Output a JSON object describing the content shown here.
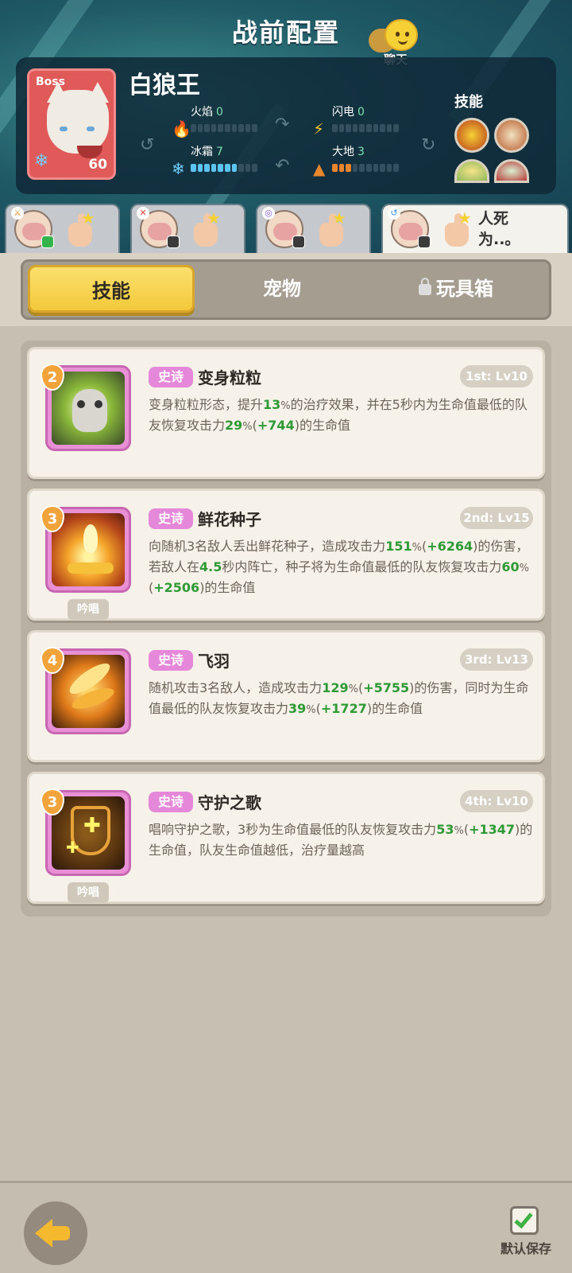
{
  "header": {
    "title": "战前配置",
    "chat_label": "聊天"
  },
  "boss": {
    "tag": "Boss",
    "name": "白狼王",
    "level": "60",
    "element_icon": "snowflake-icon",
    "stats": {
      "fire": {
        "label": "火焰",
        "value": "0",
        "filled": 0
      },
      "lightning": {
        "label": "闪电",
        "value": "0",
        "filled": 0
      },
      "frost": {
        "label": "冰霜",
        "value": "7",
        "filled": 7
      },
      "earth": {
        "label": "大地",
        "value": "3",
        "filled": 3
      }
    },
    "skills_label": "技能"
  },
  "hero_slots": [
    {
      "text": "",
      "active": false
    },
    {
      "text": "",
      "active": false
    },
    {
      "text": "",
      "active": false
    },
    {
      "text": "人死为..。",
      "active": true
    }
  ],
  "tabs": [
    {
      "label": "技能",
      "active": true
    },
    {
      "label": "宠物",
      "active": false
    },
    {
      "label": "玩具箱",
      "active": false,
      "locked": true
    }
  ],
  "skills": [
    {
      "level": "2",
      "rarity": "史诗",
      "name": "变身粒粒",
      "slot": "1st: Lv10",
      "chant": "",
      "desc_parts": [
        {
          "t": "变身粒粒形态，提升"
        },
        {
          "t": "13",
          "g": true
        },
        {
          "t": "%",
          "s": true
        },
        {
          "t": "的治疗效果，并在5秒内为生命值最低的队友恢复攻击力"
        },
        {
          "t": "29",
          "g": true
        },
        {
          "t": "%",
          "s": true
        },
        {
          "t": "("
        },
        {
          "t": "+744",
          "g": true
        },
        {
          "t": ")的生命值"
        }
      ]
    },
    {
      "level": "3",
      "rarity": "史诗",
      "name": "鲜花种子",
      "slot": "2nd: Lv15",
      "chant": "吟唱",
      "desc_parts": [
        {
          "t": "向随机3名敌人丢出鲜花种子，造成攻击力"
        },
        {
          "t": "151",
          "g": true
        },
        {
          "t": "%",
          "s": true
        },
        {
          "t": "("
        },
        {
          "t": "+6264",
          "g": true
        },
        {
          "t": ")的伤害，若敌人在"
        },
        {
          "t": "4.5",
          "g": true
        },
        {
          "t": "秒内阵亡，种子将为生命值最低的队友恢复攻击力"
        },
        {
          "t": "60",
          "g": true
        },
        {
          "t": "%",
          "s": true
        },
        {
          "t": "("
        },
        {
          "t": "+2506",
          "g": true
        },
        {
          "t": ")的生命值"
        }
      ]
    },
    {
      "level": "4",
      "rarity": "史诗",
      "name": "飞羽",
      "slot": "3rd: Lv13",
      "chant": "",
      "desc_parts": [
        {
          "t": "随机攻击3名敌人，造成攻击力"
        },
        {
          "t": "129",
          "g": true
        },
        {
          "t": "%",
          "s": true
        },
        {
          "t": "("
        },
        {
          "t": "+5755",
          "g": true
        },
        {
          "t": ")的伤害，同时为生命值最低的队友恢复攻击力"
        },
        {
          "t": "39",
          "g": true
        },
        {
          "t": "%",
          "s": true
        },
        {
          "t": "("
        },
        {
          "t": "+1727",
          "g": true
        },
        {
          "t": ")的生命值"
        }
      ]
    },
    {
      "level": "3",
      "rarity": "史诗",
      "name": "守护之歌",
      "slot": "4th: Lv10",
      "chant": "吟唱",
      "desc_parts": [
        {
          "t": "唱响守护之歌，3秒为生命值最低的队友恢复攻击力"
        },
        {
          "t": "53",
          "g": true
        },
        {
          "t": "%",
          "s": true
        },
        {
          "t": "("
        },
        {
          "t": "+1347",
          "g": true
        },
        {
          "t": ")的生命值，队友生命值越低，治疗量越高"
        }
      ]
    }
  ],
  "footer": {
    "save_label": "默认保存"
  },
  "colors": {
    "rarity_epic": "#e588da",
    "highlight_green": "#2f9a35",
    "tab_active": "#f3c93b"
  }
}
